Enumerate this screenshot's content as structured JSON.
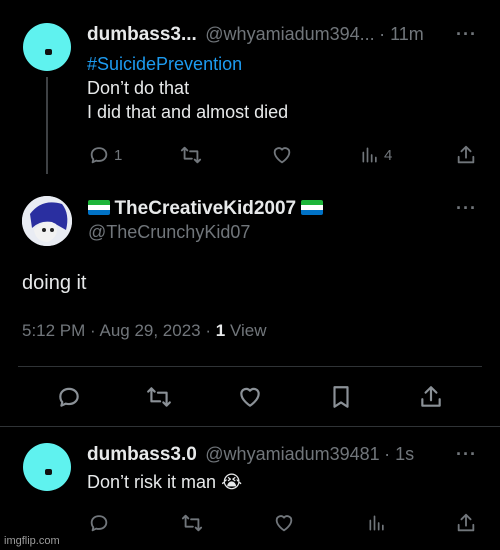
{
  "tweet1": {
    "name": "dumbass3...",
    "handle": "@whyamiadum394...",
    "time": "· 11m",
    "hashtag": "#SuicidePrevention",
    "line1": "Don’t do that",
    "line2": "I did that and almost died",
    "replies": "1",
    "views": "4"
  },
  "main_tweet": {
    "name": "TheCreativeKid2007",
    "handle": "@TheCrunchyKid07",
    "text": "doing it",
    "timestamp": "5:12 PM · Aug 29, 2023 · ",
    "views_count": "1",
    "views_label": "View"
  },
  "reply": {
    "name": "dumbass3.0",
    "handle": "@whyamiadum39481",
    "time": "· 1s",
    "text": "Don’t risk it man",
    "emoji": "😭"
  },
  "more_label": "···",
  "watermark": "imgflip.com",
  "colors": {
    "background": "#000000",
    "accent": "#1d9bf0",
    "muted": "#71767b",
    "avatar": "#5ff2ef"
  },
  "icons": [
    "reply-icon",
    "retweet-icon",
    "like-icon",
    "views-icon",
    "share-icon",
    "bookmark-icon",
    "more-icon"
  ]
}
